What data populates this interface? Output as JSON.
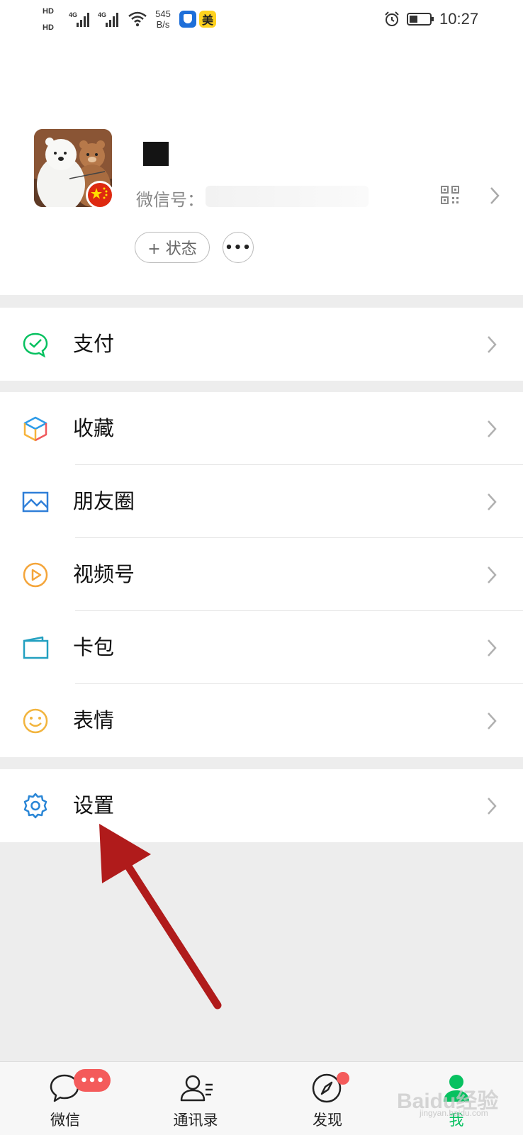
{
  "status_bar": {
    "hd1": "HD",
    "hd2": "HD",
    "sig1": "4G",
    "sig2": "4G",
    "net_speed": "545",
    "net_unit": "B/s",
    "app_badge": "美",
    "time": "10:27"
  },
  "profile": {
    "wechat_id_label": "微信号：",
    "status_button": "+ 状态",
    "more_button": "•••"
  },
  "menu": {
    "pay": "支付",
    "favorites": "收藏",
    "moments": "朋友圈",
    "channels": "视频号",
    "cards": "卡包",
    "stickers": "表情",
    "settings": "设置"
  },
  "tabbar": {
    "chats": "微信",
    "contacts": "通讯录",
    "discover": "发现",
    "me": "我",
    "chats_badge": "•••"
  },
  "watermark": {
    "brand": "Baidu经验",
    "url": "jingyan.baidu.com"
  },
  "colors": {
    "accent_green": "#07c160",
    "badge_red": "#f45b5b",
    "arrow_red": "#b01b1b"
  }
}
